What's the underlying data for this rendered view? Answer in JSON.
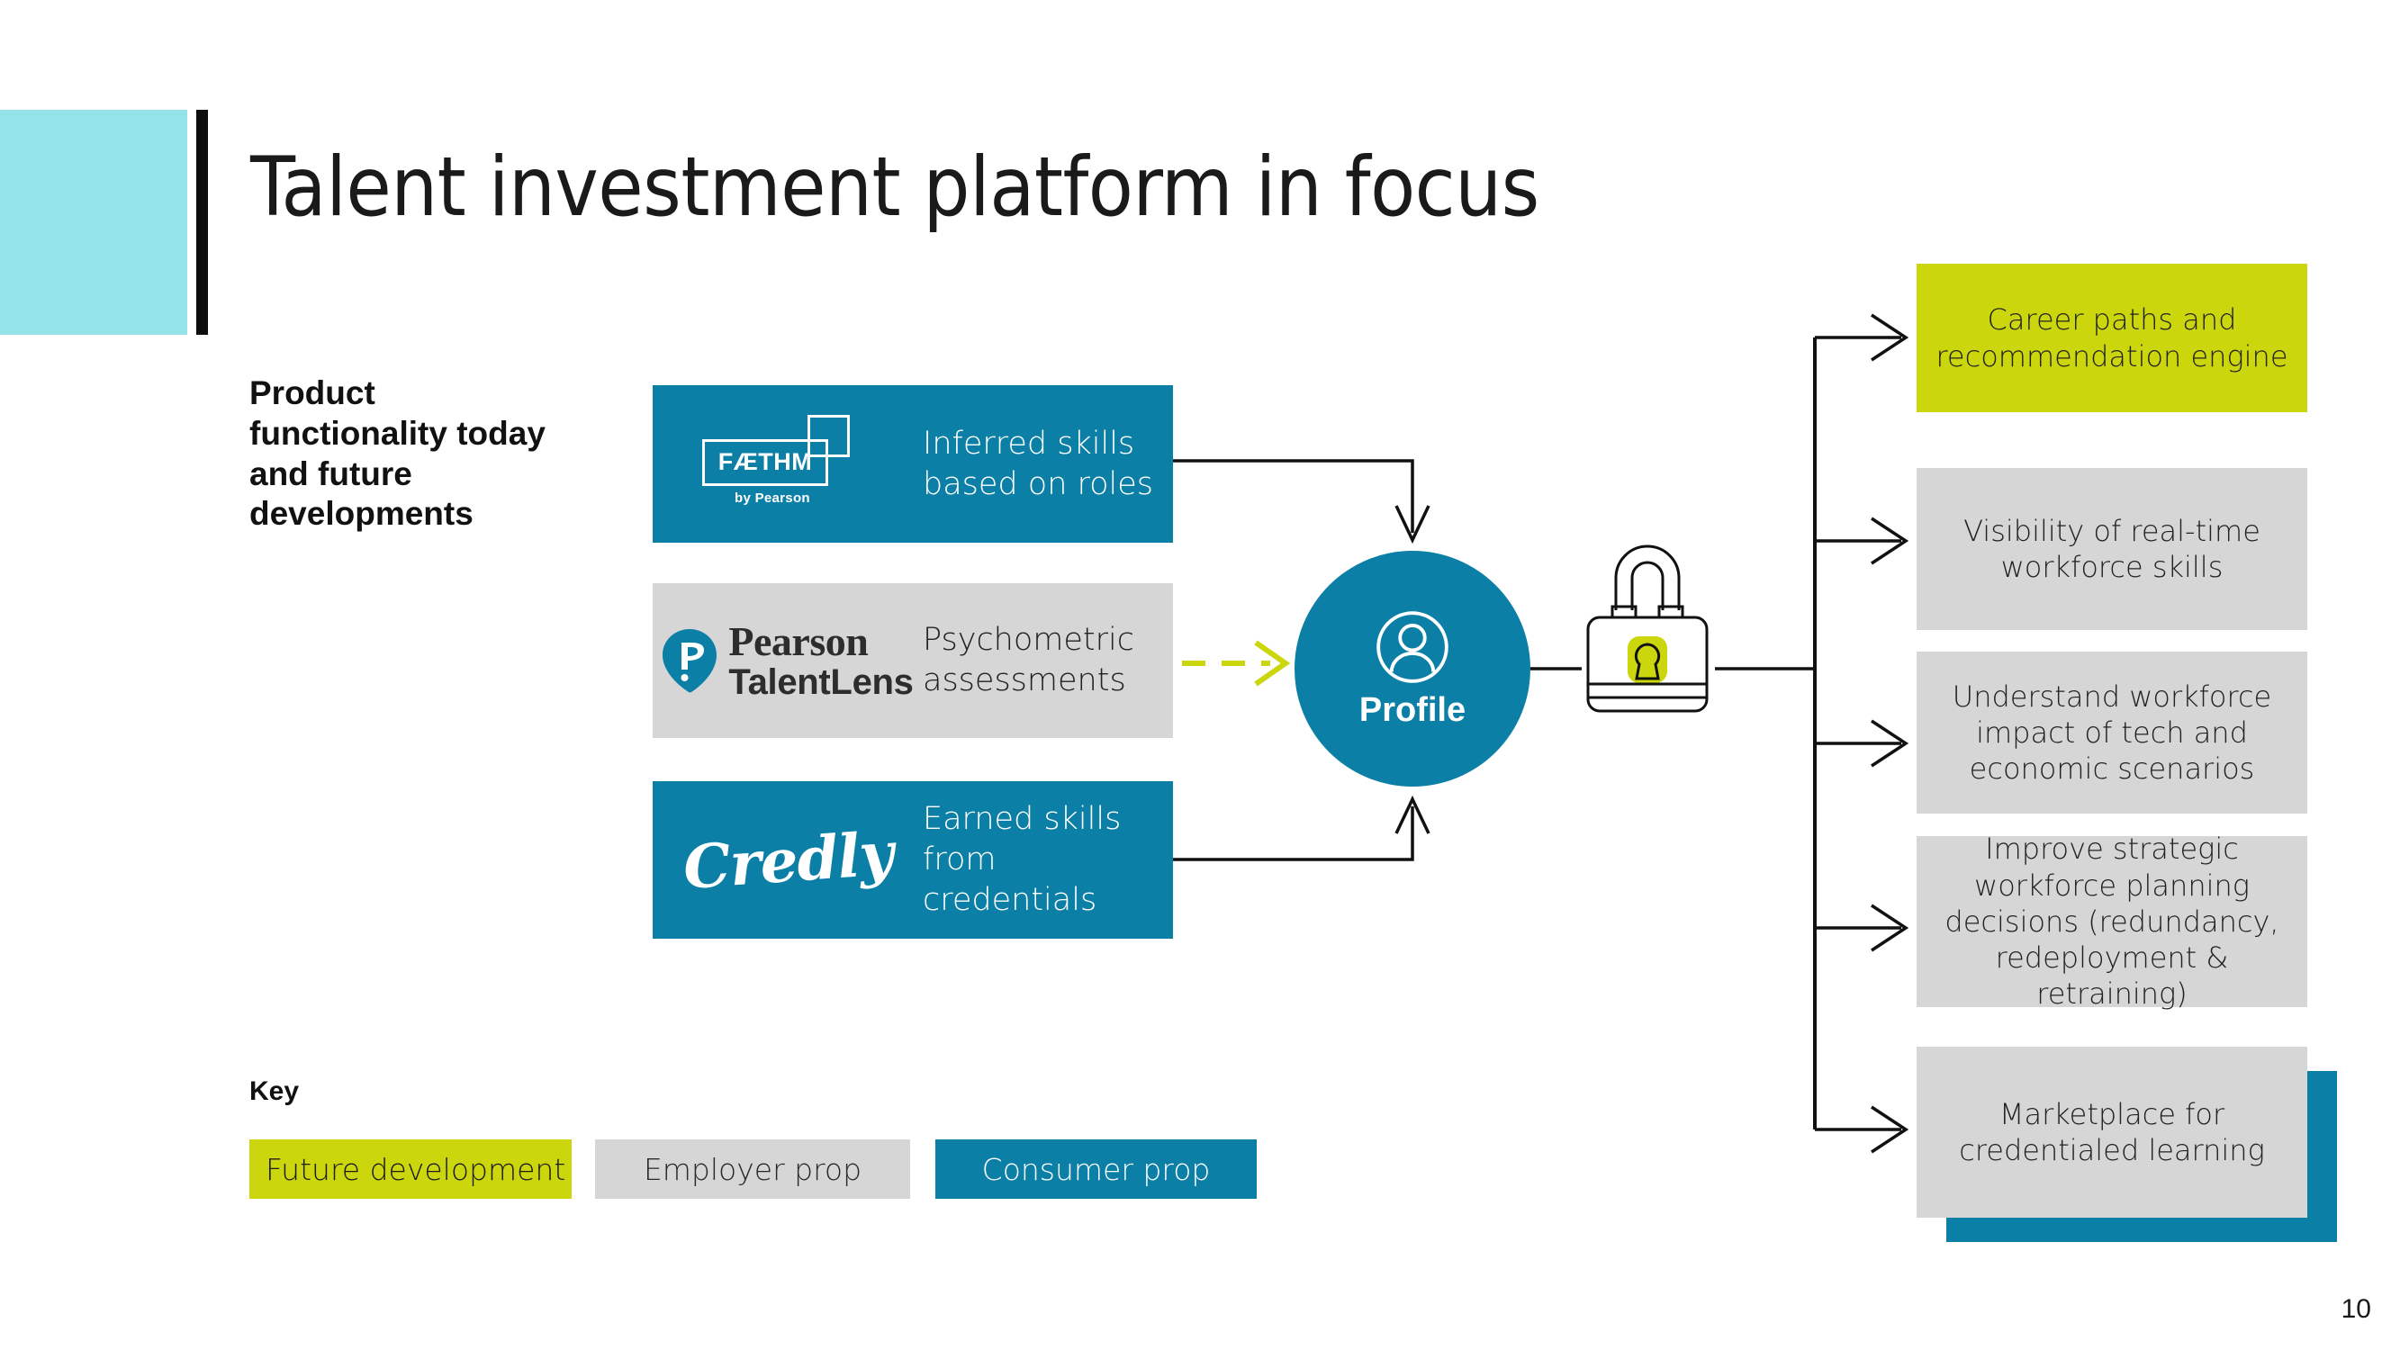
{
  "slide": {
    "title": "Talent investment platform in focus",
    "page_number": "10"
  },
  "colors": {
    "teal": "#0b7fa5",
    "lime": "#cbd60c",
    "grey": "#d6d6d6",
    "cyan_accent": "#93e3e8",
    "black_bar": "#0d0d0d"
  },
  "left_column": {
    "heading": "Product functionality today and future developments"
  },
  "sources": [
    {
      "id": "faethm",
      "logo_name": "faethm-logo",
      "logo_word": "FÆTHM",
      "logo_subtitle": "by Pearson",
      "caption": "Inferred skills based on roles",
      "style": "teal"
    },
    {
      "id": "pearson-talentlens",
      "logo_name": "pearson-talentlens-logo",
      "logo_word": "Pearson",
      "logo_subtitle": "TalentLens",
      "caption": "Psychometric assessments",
      "style": "grey"
    },
    {
      "id": "credly",
      "logo_name": "credly-logo",
      "logo_word": "Credly",
      "logo_subtitle": "",
      "caption": "Earned skills from credentials",
      "style": "teal"
    }
  ],
  "hub": {
    "label": "Profile",
    "icon": "person-icon"
  },
  "gate": {
    "icon": "padlock-icon"
  },
  "outcomes": [
    {
      "label": "Career paths and recommendation engine",
      "style": "lime"
    },
    {
      "label": "Visibility of real-time workforce skills",
      "style": "grey"
    },
    {
      "label": "Understand workforce impact of tech and economic scenarios",
      "style": "grey"
    },
    {
      "label": "Improve strategic workforce planning decisions (redundancy, redeployment & retraining)",
      "style": "grey"
    },
    {
      "label": "Marketplace for credentialed learning",
      "style": "grey"
    }
  ],
  "key": {
    "title": "Key",
    "items": [
      {
        "label": "Future development",
        "style": "lime"
      },
      {
        "label": "Employer prop",
        "style": "grey"
      },
      {
        "label": "Consumer prop",
        "style": "teal"
      }
    ]
  }
}
